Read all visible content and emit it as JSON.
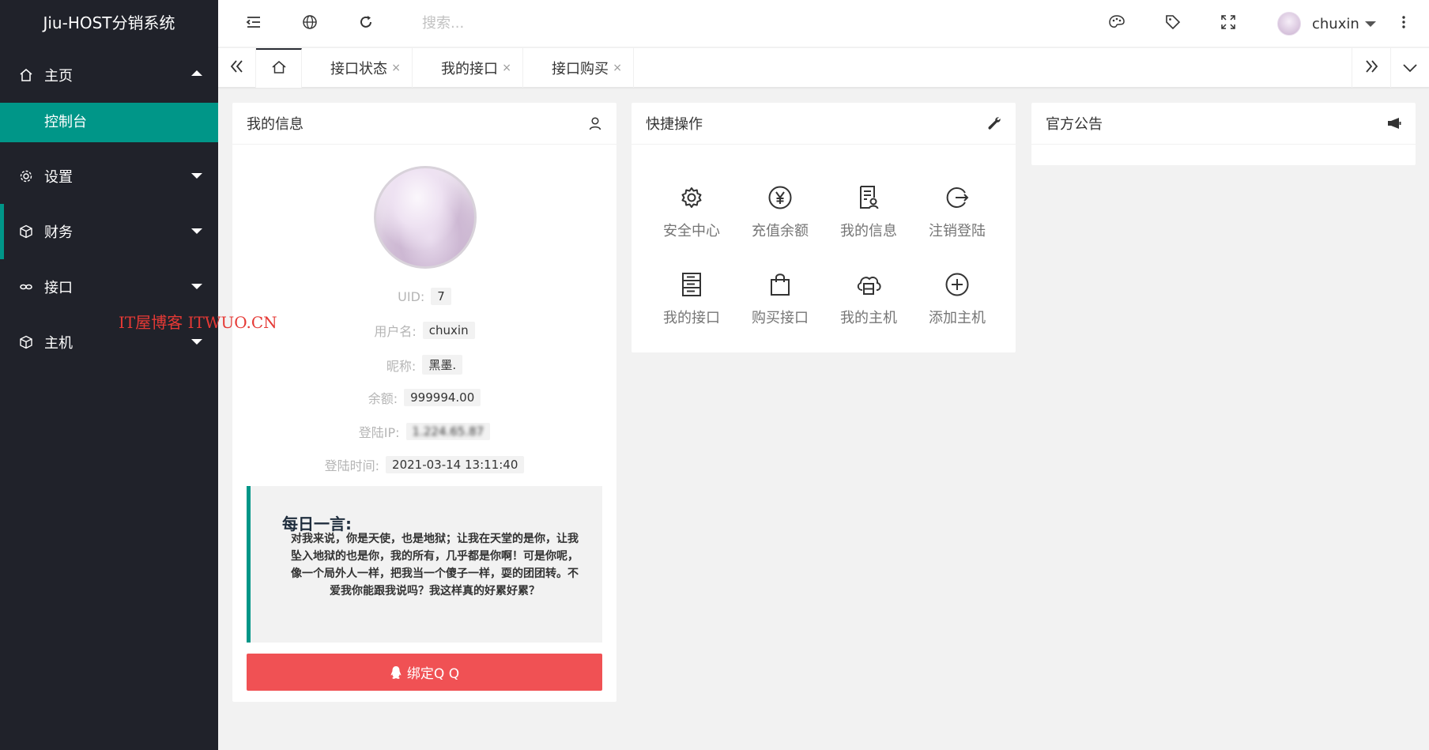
{
  "app": {
    "title": "Jiu-HOST分销系统"
  },
  "sidebar": {
    "items": [
      {
        "label": "主页",
        "icon": "home-icon",
        "expanded": true,
        "children": [
          {
            "label": "控制台",
            "active": true
          }
        ]
      },
      {
        "label": "设置",
        "icon": "gear-icon"
      },
      {
        "label": "财务",
        "icon": "cube-icon"
      },
      {
        "label": "接口",
        "icon": "link-icon"
      },
      {
        "label": "主机",
        "icon": "cube-icon"
      }
    ]
  },
  "watermark": "IT屋博客 ITWUO.CN",
  "header": {
    "search_placeholder": "搜索...",
    "username": "chuxin",
    "icons": [
      "menu-fold-icon",
      "globe-icon",
      "refresh-icon",
      "palette-icon",
      "tag-icon",
      "fullscreen-icon",
      "more-vertical-icon"
    ]
  },
  "tabs": {
    "items": [
      {
        "label": "接口状态"
      },
      {
        "label": "我的接口"
      },
      {
        "label": "接口购买"
      }
    ],
    "close_glyph": "×"
  },
  "my_info": {
    "title": "我的信息",
    "fields": [
      {
        "label": "UID:",
        "value": "7"
      },
      {
        "label": "用户名:",
        "value": "chuxin"
      },
      {
        "label": "昵称:",
        "value": "黑墨."
      },
      {
        "label": "余额:",
        "value": "999994.00"
      },
      {
        "label": "登陆IP:",
        "value": "1.224.65.87"
      },
      {
        "label": "登陆时间:",
        "value": "2021-03-14 13:11:40"
      }
    ],
    "quote_title": "每日一言:",
    "quote_text": "对我来说，你是天使，也是地狱；让我在天堂的是你，让我坠入地狱的也是你，我的所有，几乎都是你啊！可是你呢，像一个局外人一样，把我当一个傻子一样，耍的团团转。不爱我你能跟我说吗？我这样真的好累好累？",
    "bind_qq_label": "绑定Q Q"
  },
  "quick_ops": {
    "title": "快捷操作",
    "items": [
      {
        "label": "安全中心",
        "icon": "settings-icon"
      },
      {
        "label": "充值余额",
        "icon": "yen-icon"
      },
      {
        "label": "我的信息",
        "icon": "profile-doc-icon"
      },
      {
        "label": "注销登陆",
        "icon": "logout-icon"
      },
      {
        "label": "我的接口",
        "icon": "server-icon"
      },
      {
        "label": "购买接口",
        "icon": "shopping-bag-icon"
      },
      {
        "label": "我的主机",
        "icon": "cloud-host-icon"
      },
      {
        "label": "添加主机",
        "icon": "plus-circle-icon"
      }
    ]
  },
  "notice": {
    "title": "官方公告"
  },
  "colors": {
    "sidebar_bg": "#20222a",
    "accent": "#009688",
    "danger": "#f05154"
  }
}
